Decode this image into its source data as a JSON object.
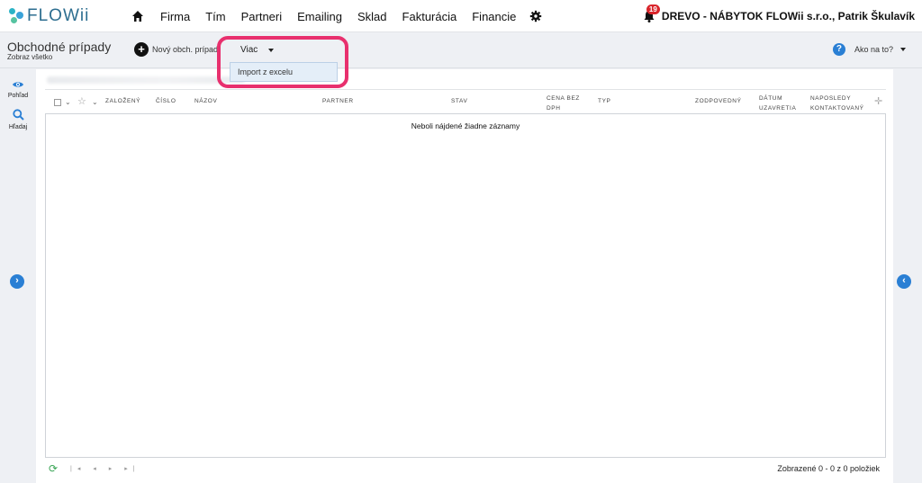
{
  "app": {
    "logo_text": "FLOWii"
  },
  "nav": {
    "items": [
      "Firma",
      "Tím",
      "Partneri",
      "Emailing",
      "Sklad",
      "Fakturácia",
      "Financie"
    ]
  },
  "user": {
    "notification_count": "19",
    "name": "DREVO - NÁBYTOK FLOWii s.r.o., Patrik Škulavík"
  },
  "toolbar": {
    "title": "Obchodné prípady",
    "subtitle": "Zobraz všetko",
    "new_label": "Nový obch. prípad",
    "more_label": "Viac",
    "dropdown_item": "Import z excelu",
    "help_label": "Ako na to?"
  },
  "sidebar": {
    "view_label": "Pohľad",
    "search_label": "Hľadaj"
  },
  "table": {
    "columns": {
      "created": "Založený",
      "number": "Číslo",
      "name": "Názov",
      "partner": "Partner",
      "status": "Stav",
      "price_line1": "Cena bez",
      "price_line2": "DPH",
      "type": "Typ",
      "owner": "Zodpovedný",
      "close_line1": "Dátum",
      "close_line2": "uzavretia",
      "contact_line1": "Naposledy",
      "contact_line2": "kontaktovaný"
    },
    "empty_message": "Neboli nájdené žiadne záznamy"
  },
  "footer": {
    "count_text": "Zobrazené 0 - 0 z 0 položiek"
  },
  "colors": {
    "brand": "#2d6e90",
    "accent": "#2a7fd4",
    "highlight": "#e8306e",
    "badge": "#d9252b"
  }
}
